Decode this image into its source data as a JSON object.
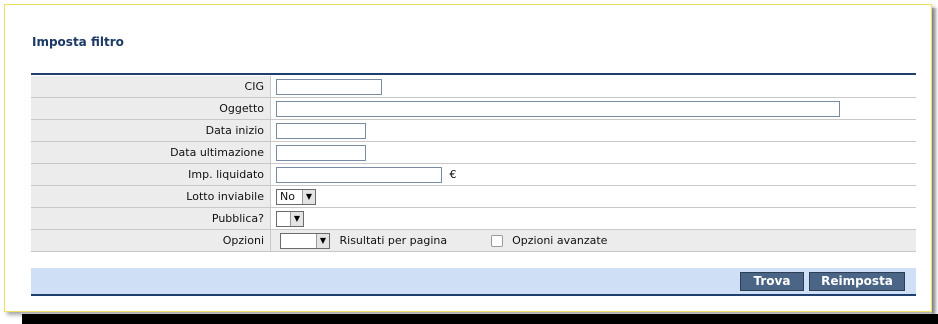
{
  "filter": {
    "title": "Imposta filtro",
    "fields": {
      "cig_label": "CIG",
      "cig_value": "",
      "oggetto_label": "Oggetto",
      "oggetto_value": "",
      "data_inizio_label": "Data inizio",
      "data_inizio_value": "",
      "data_ultimazione_label": "Data ultimazione",
      "data_ultimazione_value": "",
      "imp_liquidato_label": "Imp. liquidato",
      "imp_liquidato_value": "",
      "currency_symbol": "€",
      "lotto_inviabile_label": "Lotto inviabile",
      "lotto_inviabile_selected": "No",
      "pubblica_label": "Pubblica?",
      "pubblica_selected": "",
      "opzioni_label": "Opzioni",
      "risultati_selected": "",
      "risultati_label": "Risultati per pagina",
      "opzioni_avanzate_label": "Opzioni avanzate",
      "opzioni_avanzate_checked": false
    },
    "buttons": {
      "trova": "Trova",
      "reimposta": "Reimposta"
    }
  },
  "colors": {
    "title": "#1c3a66",
    "rule": "#1f3f6e",
    "label_bg": "#ececec",
    "button_bar": "#cfe0f6",
    "button": "#4b6586"
  },
  "icons": {
    "dropdown": "chevron-down-icon",
    "checkbox": "checkbox-icon"
  }
}
